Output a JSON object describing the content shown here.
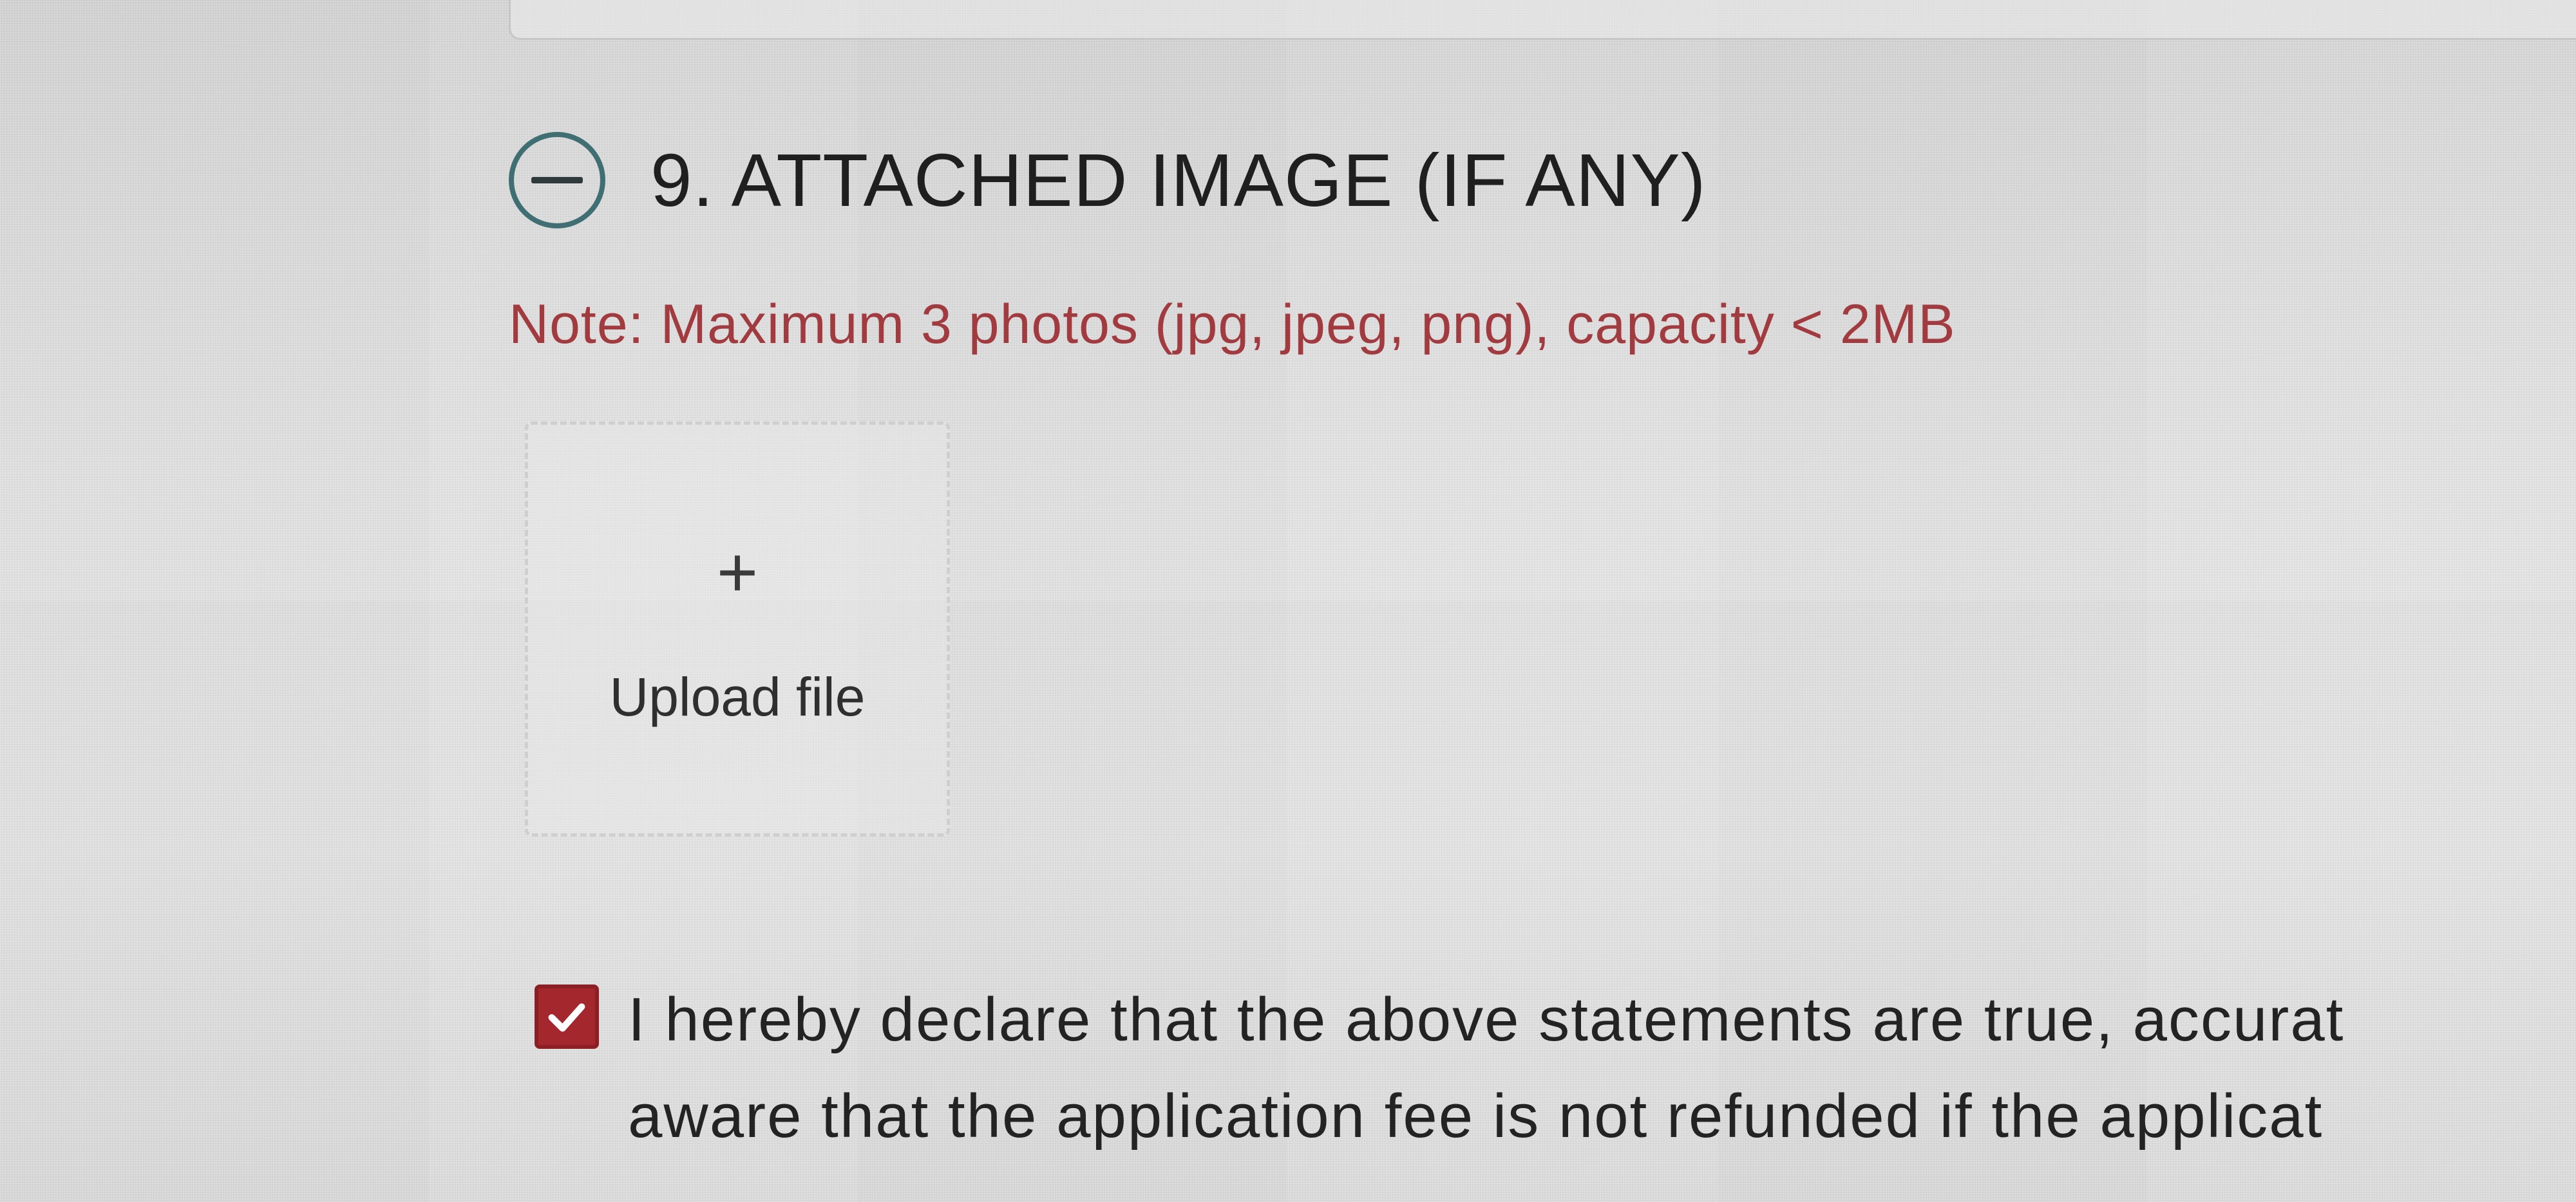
{
  "section": {
    "number_title": "9. ATTACHED IMAGE (IF ANY)",
    "collapse_icon": "minus-circle-icon",
    "note": "Note: Maximum 3 photos (jpg, jpeg, png), capacity < 2MB"
  },
  "upload": {
    "plus_symbol": "+",
    "label": "Upload file"
  },
  "declaration": {
    "checked": true,
    "line1": "I hereby declare that the above statements are true, accurat",
    "line2": "aware that the application fee is not refunded if the applicat"
  },
  "colors": {
    "note_red": "#a23b40",
    "checkbox_red": "#a3272d",
    "collapse_teal": "#3f6f73"
  }
}
